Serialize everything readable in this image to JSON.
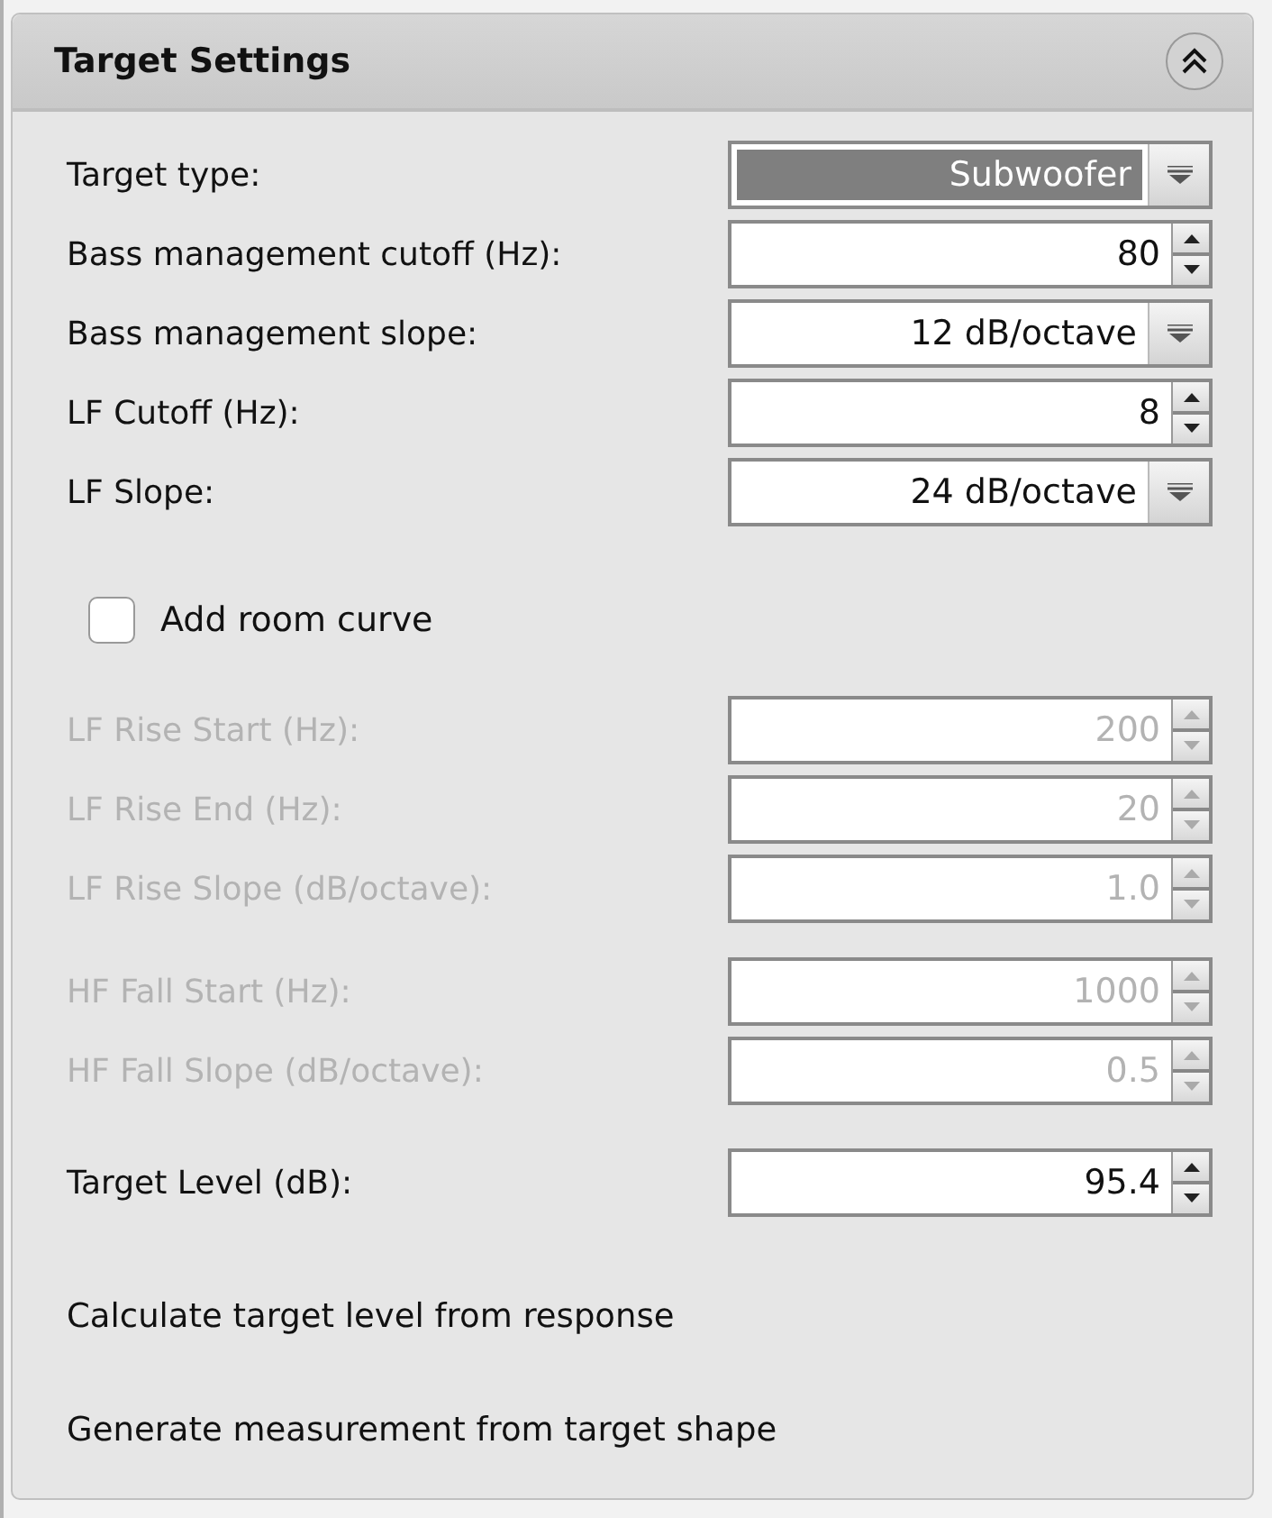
{
  "panel": {
    "title": "Target Settings",
    "expanded": true
  },
  "groups": [
    {
      "rows": [
        {
          "label": "Target type:",
          "kind": "combo",
          "value": "Subwoofer",
          "focused": true,
          "disabled": false
        },
        {
          "label": "Bass management cutoff (Hz):",
          "kind": "spinner",
          "value": "80",
          "focused": false,
          "disabled": false
        },
        {
          "label": "Bass management slope:",
          "kind": "combo",
          "value": "12 dB/octave",
          "focused": false,
          "disabled": false
        },
        {
          "label": "LF Cutoff (Hz):",
          "kind": "spinner",
          "value": "8",
          "focused": false,
          "disabled": false
        },
        {
          "label": "LF Slope:",
          "kind": "combo",
          "value": "24 dB/octave",
          "focused": false,
          "disabled": false
        }
      ]
    },
    {
      "checkbox": {
        "label": "Add room curve",
        "checked": false
      }
    },
    {
      "rows": [
        {
          "label": "LF Rise Start (Hz):",
          "kind": "spinner",
          "value": "200",
          "focused": false,
          "disabled": true
        },
        {
          "label": "LF Rise End (Hz):",
          "kind": "spinner",
          "value": "20",
          "focused": false,
          "disabled": true
        },
        {
          "label": "LF Rise Slope (dB/octave):",
          "kind": "spinner",
          "value": "1.0",
          "focused": false,
          "disabled": true
        }
      ]
    },
    {
      "rows": [
        {
          "label": "HF Fall Start (Hz):",
          "kind": "spinner",
          "value": "1000",
          "focused": false,
          "disabled": true
        },
        {
          "label": "HF Fall Slope (dB/octave):",
          "kind": "spinner",
          "value": "0.5",
          "focused": false,
          "disabled": true
        }
      ]
    },
    {
      "rows": [
        {
          "label": "Target Level (dB):",
          "kind": "spinner",
          "value": "95.4",
          "focused": false,
          "disabled": false
        }
      ]
    }
  ],
  "actions": [
    "Calculate target level from response",
    "Generate measurement from target shape"
  ]
}
